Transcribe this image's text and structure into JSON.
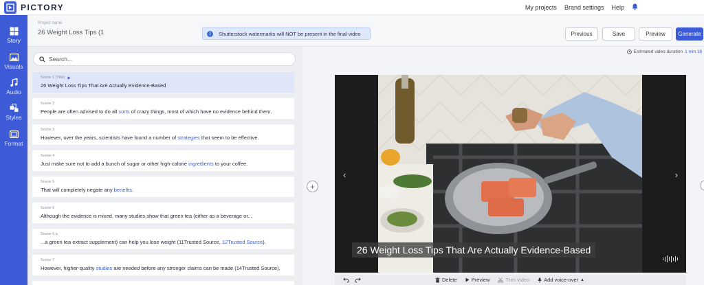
{
  "app": {
    "name": "PICTORY"
  },
  "topnav": {
    "items": [
      "My projects",
      "Brand settings",
      "Help"
    ]
  },
  "sidebar": {
    "items": [
      {
        "label": "Story",
        "icon": "story-grid-icon"
      },
      {
        "label": "Visuals",
        "icon": "image-icon"
      },
      {
        "label": "Audio",
        "icon": "music-note-icon"
      },
      {
        "label": "Styles",
        "icon": "styles-icon"
      },
      {
        "label": "Format",
        "icon": "format-icon"
      }
    ],
    "active": "Story"
  },
  "header": {
    "project_label": "Project name",
    "project_name": "26 Weight Loss Tips (1",
    "notice": "Shutterstock watermarks will NOT be present in the final video",
    "buttons": {
      "previous": "Previous",
      "save": "Save",
      "preview": "Preview",
      "generate": "Generate"
    }
  },
  "search": {
    "placeholder": "Search..."
  },
  "scenes": [
    {
      "label": "Scene 1 (Title)",
      "text_parts": [
        "26 Weight Loss Tips That Are Actually Evidence-Based"
      ]
    },
    {
      "label": "Scene 2",
      "pre": "People are often advised to do all ",
      "kw": "sorts",
      "post": " of crazy things, most of which have no evidence behind them."
    },
    {
      "label": "Scene 3",
      "pre": "However, over the years, scientists have found a number of ",
      "kw": "strategies",
      "post": " that seem to be effective."
    },
    {
      "label": "Scene 4",
      "pre": "Just make sure not to add a bunch of sugar or other high-calorie ",
      "kw": "ingredients",
      "post": " to your coffee."
    },
    {
      "label": "Scene 5",
      "pre": "That will completely negate any ",
      "kw": "benefits",
      "post": "."
    },
    {
      "label": "Scene 6",
      "pre": "Although the evidence is mixed, many studies show that green tea (either as a beverage or...",
      "kw": "",
      "post": ""
    },
    {
      "label": "Scene 6.a",
      "pre": "...a green tea extract supplement) can help you lose weight (11Trusted Source, ",
      "kw": "12Trusted Source",
      "post": ")."
    },
    {
      "label": "Scene 7",
      "pre": "However, higher-quality ",
      "kw": "studies",
      "post": " are needed before any stronger claims can be made (14Trusted Source)."
    }
  ],
  "preview": {
    "duration_label": "Estimated video duration",
    "duration_value": "1 min 18",
    "caption": "26 Weight Loss Tips That Are Actually Evidence-Based"
  },
  "toolbar": {
    "delete": "Delete",
    "preview": "Preview",
    "trim": "Trim video",
    "voiceover": "Add voice-over"
  },
  "colors": {
    "brand": "#3d5bd6",
    "keyword": "#3d5bd6",
    "selected_scene": "#dfe6fa"
  }
}
